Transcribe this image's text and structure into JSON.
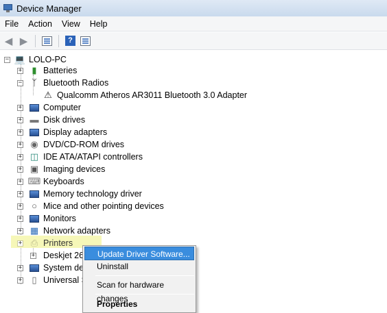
{
  "window": {
    "title": "Device Manager"
  },
  "menubar": {
    "items": [
      "File",
      "Action",
      "View",
      "Help"
    ]
  },
  "toolbar": {
    "buttons": [
      "back-arrow-icon",
      "forward-arrow-icon",
      "show-hide-tree-icon",
      "help-icon",
      "properties-icon"
    ]
  },
  "tree": {
    "root": "LOLO-PC",
    "items": [
      {
        "label": "Batteries",
        "icon": "battery-icon",
        "expanded": false
      },
      {
        "label": "Bluetooth Radios",
        "icon": "bluetooth-icon",
        "expanded": true
      },
      {
        "label": "Qualcomm Atheros AR3011 Bluetooth 3.0 Adapter",
        "icon": "bluetooth-warning-icon",
        "child": true
      },
      {
        "label": "Computer",
        "icon": "computer-icon",
        "expanded": false
      },
      {
        "label": "Disk drives",
        "icon": "disk-drive-icon",
        "expanded": false
      },
      {
        "label": "Display adapters",
        "icon": "display-adapter-icon",
        "expanded": false
      },
      {
        "label": "DVD/CD-ROM drives",
        "icon": "dvd-drive-icon",
        "expanded": false
      },
      {
        "label": "IDE ATA/ATAPI controllers",
        "icon": "ide-controller-icon",
        "expanded": false
      },
      {
        "label": "Imaging devices",
        "icon": "camera-icon",
        "expanded": false
      },
      {
        "label": "Keyboards",
        "icon": "keyboard-icon",
        "expanded": false
      },
      {
        "label": "Memory technology driver",
        "icon": "memory-icon",
        "expanded": false
      },
      {
        "label": "Mice and other pointing devices",
        "icon": "mouse-icon",
        "expanded": false
      },
      {
        "label": "Monitors",
        "icon": "monitor-icon",
        "expanded": false
      },
      {
        "label": "Network adapters",
        "icon": "network-adapter-icon",
        "expanded": false
      },
      {
        "label": "Printers",
        "icon": "printer-icon",
        "expanded": true,
        "highlighted": true
      },
      {
        "label": "Deskjet 26",
        "icon": "",
        "child": true
      },
      {
        "label": "System dev",
        "icon": "system-device-icon",
        "expanded": false
      },
      {
        "label": "Universal S",
        "icon": "usb-icon",
        "expanded": false
      }
    ]
  },
  "context_menu": {
    "items": [
      {
        "label": "Update Driver Software...",
        "highlighted": true
      },
      {
        "label": "Uninstall"
      },
      {
        "label": "Scan for hardware changes"
      },
      {
        "label": "Properties",
        "bold": true
      }
    ]
  },
  "colors": {
    "highlight": "#3a8dde",
    "selection_yellow": "#f6f7b8"
  }
}
